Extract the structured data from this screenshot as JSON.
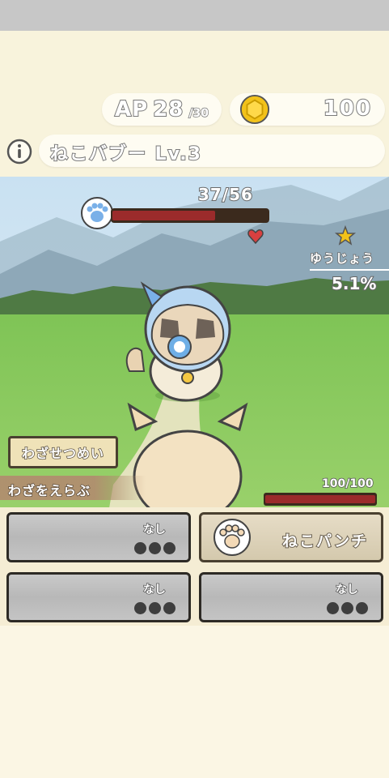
{
  "resources": {
    "ap_label": "AP",
    "ap_current": "28",
    "ap_max": "/30",
    "coins": "100"
  },
  "enemy": {
    "name": "ねこバブー Lv.3",
    "hp_text": "37/56",
    "hp_fraction": 0.66
  },
  "growth": {
    "label": "ゆうじょう",
    "value": "5.1%"
  },
  "controls": {
    "skill_description_button": "わざせつめい",
    "choose_skill_label": "わざをえらぶ"
  },
  "player": {
    "hp_text": "100/100",
    "hp_fraction": 1.0
  },
  "skills": [
    {
      "name": "なし",
      "active": false
    },
    {
      "name": "ねこパンチ",
      "active": true
    },
    {
      "name": "なし",
      "active": false
    },
    {
      "name": "なし",
      "active": false
    }
  ],
  "colors": {
    "hp_fill": "#9b2b2b",
    "coin": "#f2c21a",
    "paw_blue": "#7ab0e8"
  },
  "icons": [
    "coin-icon",
    "info-icon",
    "paw-icon",
    "star-icon",
    "heart-icon"
  ]
}
